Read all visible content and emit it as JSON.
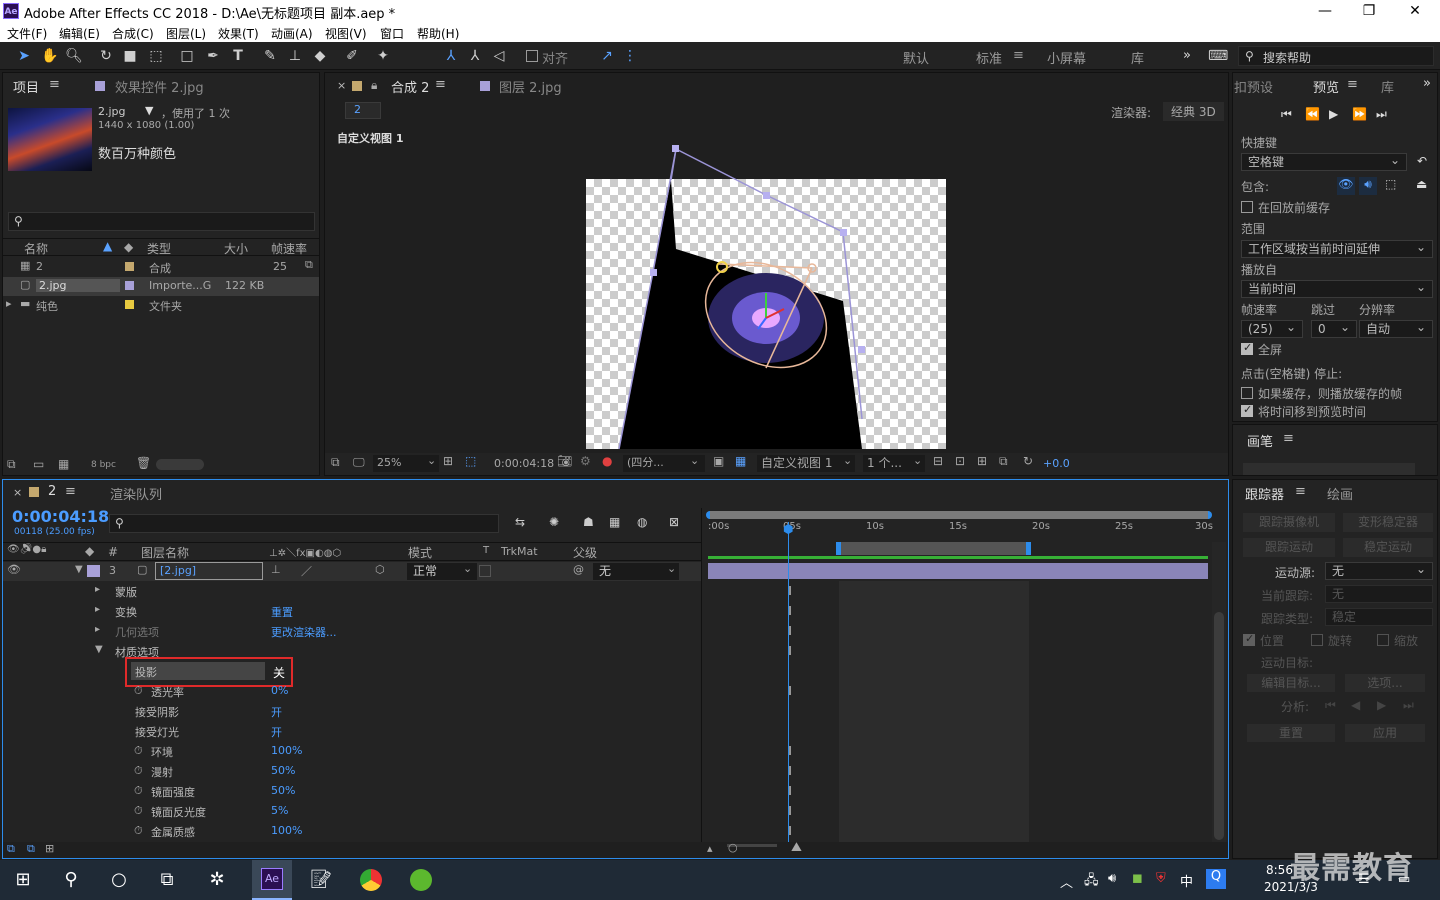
{
  "window": {
    "app_logo": "Ae",
    "title": "Adobe After Effects CC 2018 - D:\\Ae\\无标题项目 副本.aep *",
    "minimize": "—",
    "maximize": "❐",
    "close": "✕"
  },
  "menu": [
    "文件(F)",
    "编辑(E)",
    "合成(C)",
    "图层(L)",
    "效果(T)",
    "动画(A)",
    "视图(V)",
    "窗口",
    "帮助(H)"
  ],
  "toolbar": {
    "snap_label": "对齐",
    "workspaces": [
      "默认",
      "标准",
      "小屏幕",
      "库"
    ],
    "active_workspace": "标准",
    "search_placeholder": "搜索帮助",
    "more": "»"
  },
  "project": {
    "tab": "项目",
    "tab2": "效果控件 2.jpg",
    "item_name": "2.jpg",
    "usage": "，使用了 1 次",
    "dims": "1440 x 1080 (1.00)",
    "colors": "数百万种颜色",
    "columns": {
      "name": "名称",
      "type": "类型",
      "size": "大小",
      "fps": "帧速率"
    },
    "items": [
      {
        "name": "2",
        "type": "合成",
        "size": "",
        "fps": "25",
        "label_color": "#c4a86e"
      },
      {
        "name": "2.jpg",
        "type": "Importe...G",
        "size": "122 KB",
        "fps": "",
        "label_color": "#a8a0d8"
      },
      {
        "name": "纯色",
        "type": "文件夹",
        "size": "",
        "fps": "",
        "label_color": "#e7c940"
      }
    ],
    "bpc": "8 bpc"
  },
  "composition": {
    "tab": "合成 2",
    "tab2": "图层 2.jpg",
    "breadcrumb": "2",
    "renderer_label": "渲染器:",
    "renderer": "经典 3D",
    "view_label": "自定义视图 1",
    "footer": {
      "zoom": "25%",
      "time": "0:00:04:18",
      "quality": "(四分...",
      "view": "自定义视图 1",
      "views": "1 个...",
      "exposure": "+0.0"
    }
  },
  "preview": {
    "tab1": "扣预设",
    "tab2": "预览",
    "tab3": "库",
    "shortcut_label": "快捷键",
    "shortcut": "空格键",
    "include_label": "包含:",
    "cache_before": "在回放前缓存",
    "range_label": "范围",
    "range": "工作区域按当前时间延伸",
    "play_from_label": "播放自",
    "play_from": "当前时间",
    "fps_label": "帧速率",
    "skip_label": "跳过",
    "res_label": "分辨率",
    "fps": "(25)",
    "skip": "0",
    "res": "自动",
    "fullscreen": "全屏",
    "stop_label": "点击(空格键) 停止:",
    "if_cached": "如果缓存，则播放缓存的帧",
    "move_time": "将时间移到预览时间",
    "brush_tab": "画笔"
  },
  "timeline": {
    "tab": "2",
    "render_queue": "渲染队列",
    "timecode": "0:00:04:18",
    "frames": "00118 (25.00 fps)",
    "headers": {
      "num": "#",
      "layer_name": "图层名称",
      "mode": "模式",
      "trk": "TrkMat",
      "parent": "父级"
    },
    "layer": {
      "num": "3",
      "name": "[2.jpg]",
      "mode": "正常",
      "parent": "无"
    },
    "ruler": [
      ":00s",
      "05s",
      "10s",
      "15s",
      "20s",
      "25s",
      "30s"
    ],
    "properties": [
      {
        "name": "蒙版",
        "value": ""
      },
      {
        "name": "变换",
        "value": "重置"
      },
      {
        "name": "几何选项",
        "value": "更改渲染器..."
      },
      {
        "name": "材质选项",
        "value": ""
      },
      {
        "name": "投影",
        "value": "关"
      },
      {
        "name": "透光率",
        "value": "0%"
      },
      {
        "name": "接受阴影",
        "value": "开"
      },
      {
        "name": "接受灯光",
        "value": "开"
      },
      {
        "name": "环境",
        "value": "100%"
      },
      {
        "name": "漫射",
        "value": "50%"
      },
      {
        "name": "镜面强度",
        "value": "50%"
      },
      {
        "name": "镜面反光度",
        "value": "5%"
      },
      {
        "name": "金属质感",
        "value": "100%"
      }
    ]
  },
  "tracker": {
    "tab": "跟踪器",
    "tab2": "绘画",
    "track_camera": "跟踪摄像机",
    "warp_stab": "变形稳定器",
    "track_motion": "跟踪运动",
    "stabilize": "稳定运动",
    "motion_source_label": "运动源:",
    "motion_source": "无",
    "current_track_label": "当前跟踪:",
    "current_track": "无",
    "track_type_label": "跟踪类型:",
    "track_type": "稳定",
    "position": "位置",
    "rotation": "旋转",
    "scale": "缩放",
    "motion_target": "运动目标:",
    "edit_target": "编辑目标...",
    "options": "选项...",
    "analyze": "分析:",
    "reset": "重置",
    "apply": "应用"
  },
  "taskbar": {
    "clock": "8:56",
    "date": "2021/3/3",
    "ime": "中",
    "watermark": "最需教育"
  },
  "colors": {
    "accent": "#2d8ceb",
    "highlight_box": "#e02a2a",
    "timecode": "#4b9cff"
  }
}
